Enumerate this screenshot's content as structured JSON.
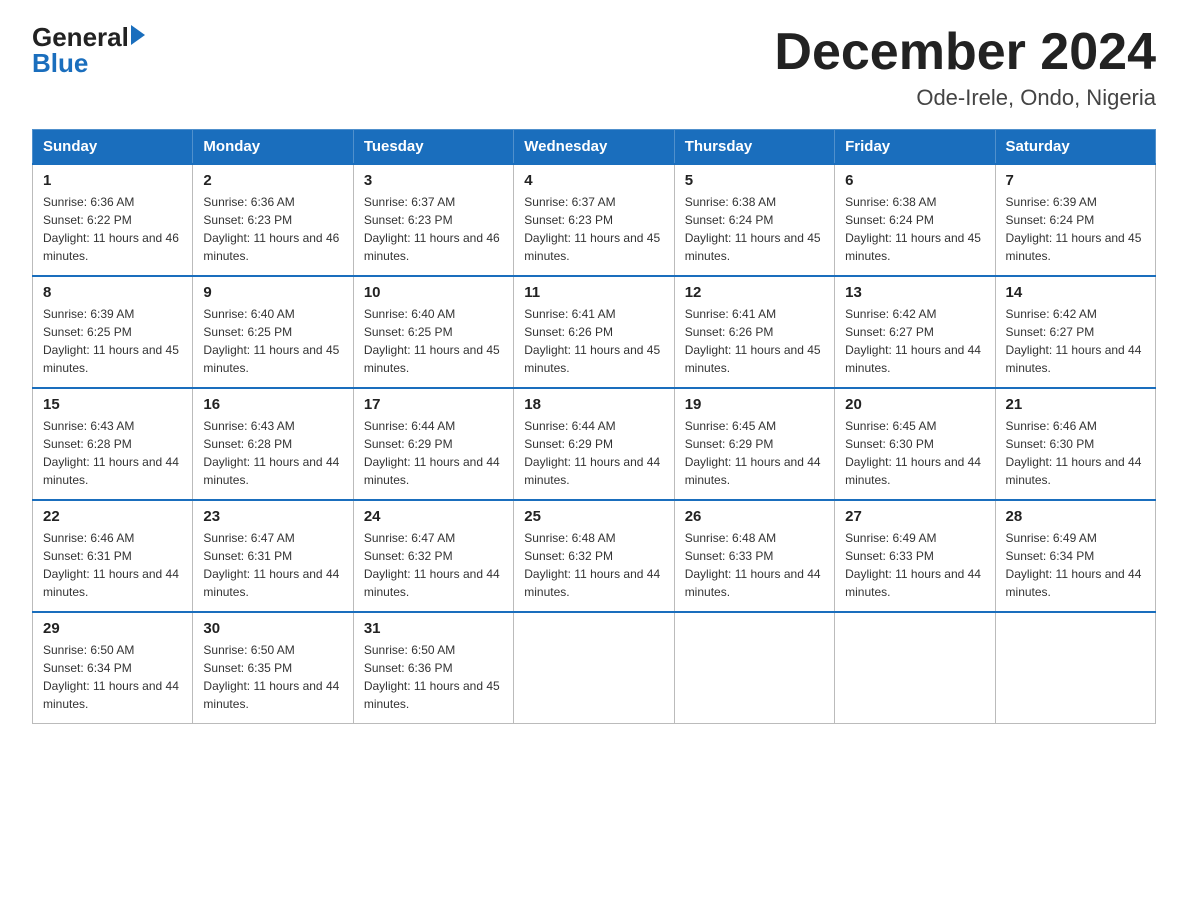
{
  "header": {
    "logo": {
      "general": "General",
      "blue": "Blue"
    },
    "title": "December 2024",
    "subtitle": "Ode-Irele, Ondo, Nigeria"
  },
  "calendar": {
    "days_of_week": [
      "Sunday",
      "Monday",
      "Tuesday",
      "Wednesday",
      "Thursday",
      "Friday",
      "Saturday"
    ],
    "weeks": [
      [
        {
          "day": "1",
          "sunrise": "6:36 AM",
          "sunset": "6:22 PM",
          "daylight": "11 hours and 46 minutes."
        },
        {
          "day": "2",
          "sunrise": "6:36 AM",
          "sunset": "6:23 PM",
          "daylight": "11 hours and 46 minutes."
        },
        {
          "day": "3",
          "sunrise": "6:37 AM",
          "sunset": "6:23 PM",
          "daylight": "11 hours and 46 minutes."
        },
        {
          "day": "4",
          "sunrise": "6:37 AM",
          "sunset": "6:23 PM",
          "daylight": "11 hours and 45 minutes."
        },
        {
          "day": "5",
          "sunrise": "6:38 AM",
          "sunset": "6:24 PM",
          "daylight": "11 hours and 45 minutes."
        },
        {
          "day": "6",
          "sunrise": "6:38 AM",
          "sunset": "6:24 PM",
          "daylight": "11 hours and 45 minutes."
        },
        {
          "day": "7",
          "sunrise": "6:39 AM",
          "sunset": "6:24 PM",
          "daylight": "11 hours and 45 minutes."
        }
      ],
      [
        {
          "day": "8",
          "sunrise": "6:39 AM",
          "sunset": "6:25 PM",
          "daylight": "11 hours and 45 minutes."
        },
        {
          "day": "9",
          "sunrise": "6:40 AM",
          "sunset": "6:25 PM",
          "daylight": "11 hours and 45 minutes."
        },
        {
          "day": "10",
          "sunrise": "6:40 AM",
          "sunset": "6:25 PM",
          "daylight": "11 hours and 45 minutes."
        },
        {
          "day": "11",
          "sunrise": "6:41 AM",
          "sunset": "6:26 PM",
          "daylight": "11 hours and 45 minutes."
        },
        {
          "day": "12",
          "sunrise": "6:41 AM",
          "sunset": "6:26 PM",
          "daylight": "11 hours and 45 minutes."
        },
        {
          "day": "13",
          "sunrise": "6:42 AM",
          "sunset": "6:27 PM",
          "daylight": "11 hours and 44 minutes."
        },
        {
          "day": "14",
          "sunrise": "6:42 AM",
          "sunset": "6:27 PM",
          "daylight": "11 hours and 44 minutes."
        }
      ],
      [
        {
          "day": "15",
          "sunrise": "6:43 AM",
          "sunset": "6:28 PM",
          "daylight": "11 hours and 44 minutes."
        },
        {
          "day": "16",
          "sunrise": "6:43 AM",
          "sunset": "6:28 PM",
          "daylight": "11 hours and 44 minutes."
        },
        {
          "day": "17",
          "sunrise": "6:44 AM",
          "sunset": "6:29 PM",
          "daylight": "11 hours and 44 minutes."
        },
        {
          "day": "18",
          "sunrise": "6:44 AM",
          "sunset": "6:29 PM",
          "daylight": "11 hours and 44 minutes."
        },
        {
          "day": "19",
          "sunrise": "6:45 AM",
          "sunset": "6:29 PM",
          "daylight": "11 hours and 44 minutes."
        },
        {
          "day": "20",
          "sunrise": "6:45 AM",
          "sunset": "6:30 PM",
          "daylight": "11 hours and 44 minutes."
        },
        {
          "day": "21",
          "sunrise": "6:46 AM",
          "sunset": "6:30 PM",
          "daylight": "11 hours and 44 minutes."
        }
      ],
      [
        {
          "day": "22",
          "sunrise": "6:46 AM",
          "sunset": "6:31 PM",
          "daylight": "11 hours and 44 minutes."
        },
        {
          "day": "23",
          "sunrise": "6:47 AM",
          "sunset": "6:31 PM",
          "daylight": "11 hours and 44 minutes."
        },
        {
          "day": "24",
          "sunrise": "6:47 AM",
          "sunset": "6:32 PM",
          "daylight": "11 hours and 44 minutes."
        },
        {
          "day": "25",
          "sunrise": "6:48 AM",
          "sunset": "6:32 PM",
          "daylight": "11 hours and 44 minutes."
        },
        {
          "day": "26",
          "sunrise": "6:48 AM",
          "sunset": "6:33 PM",
          "daylight": "11 hours and 44 minutes."
        },
        {
          "day": "27",
          "sunrise": "6:49 AM",
          "sunset": "6:33 PM",
          "daylight": "11 hours and 44 minutes."
        },
        {
          "day": "28",
          "sunrise": "6:49 AM",
          "sunset": "6:34 PM",
          "daylight": "11 hours and 44 minutes."
        }
      ],
      [
        {
          "day": "29",
          "sunrise": "6:50 AM",
          "sunset": "6:34 PM",
          "daylight": "11 hours and 44 minutes."
        },
        {
          "day": "30",
          "sunrise": "6:50 AM",
          "sunset": "6:35 PM",
          "daylight": "11 hours and 44 minutes."
        },
        {
          "day": "31",
          "sunrise": "6:50 AM",
          "sunset": "6:36 PM",
          "daylight": "11 hours and 45 minutes."
        },
        null,
        null,
        null,
        null
      ]
    ],
    "labels": {
      "sunrise": "Sunrise:",
      "sunset": "Sunset:",
      "daylight": "Daylight:"
    }
  }
}
